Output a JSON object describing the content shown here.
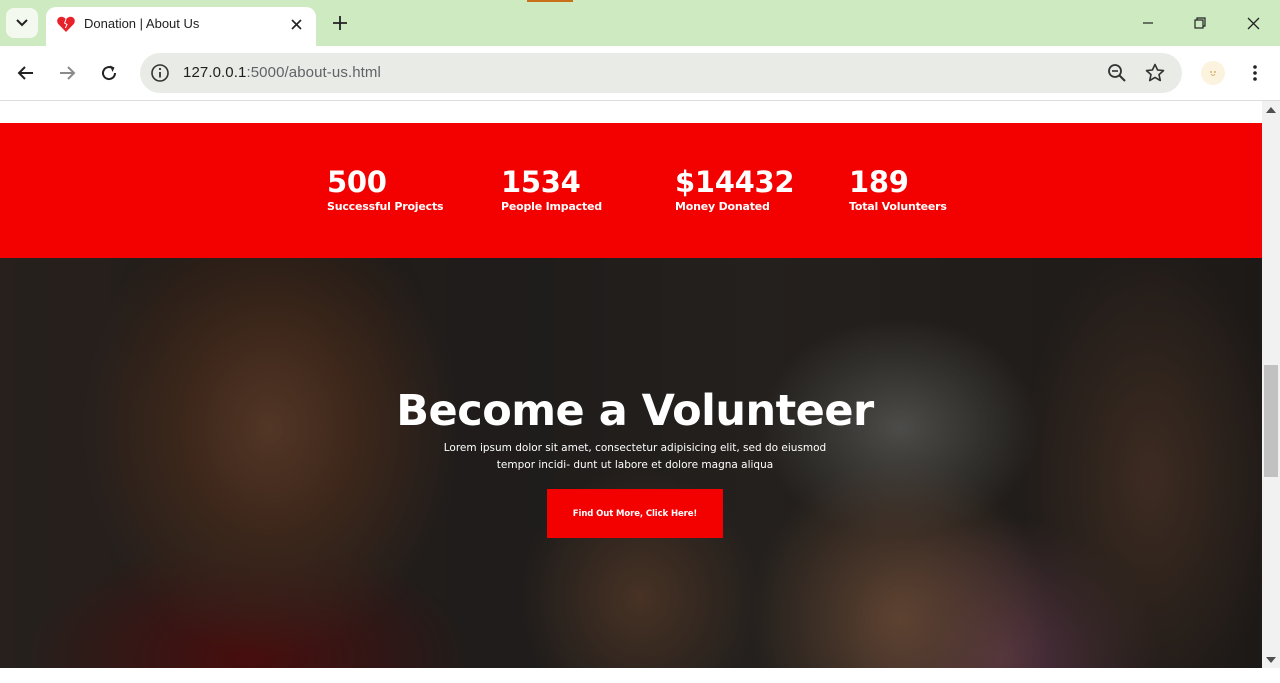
{
  "browser": {
    "tab": {
      "title": "Donation | About Us",
      "favicon": "heart-icon"
    },
    "address_bar": {
      "url_host": "127.0.0.1",
      "url_rest": ":5000/about-us.html"
    },
    "colors": {
      "tabstrip": "#cdeac0",
      "omnibox": "#e9ebe6"
    }
  },
  "page": {
    "stats": [
      {
        "value": "500",
        "label": "Successful Projects"
      },
      {
        "value": "1534",
        "label": "People Impacted"
      },
      {
        "value": "$14432",
        "label": "Money Donated"
      },
      {
        "value": "189",
        "label": "Total Volunteers"
      }
    ],
    "hero": {
      "title": "Become a Volunteer",
      "text_line1": "Lorem ipsum dolor sit amet, consectetur adipisicing elit, sed do eiusmod",
      "text_line2": "tempor incidi- dunt ut labore et dolore magna aliqua",
      "button_label": "Find Out More, Click Here!"
    },
    "colors": {
      "accent_red": "#f30000",
      "text_white": "#ffffff"
    }
  }
}
